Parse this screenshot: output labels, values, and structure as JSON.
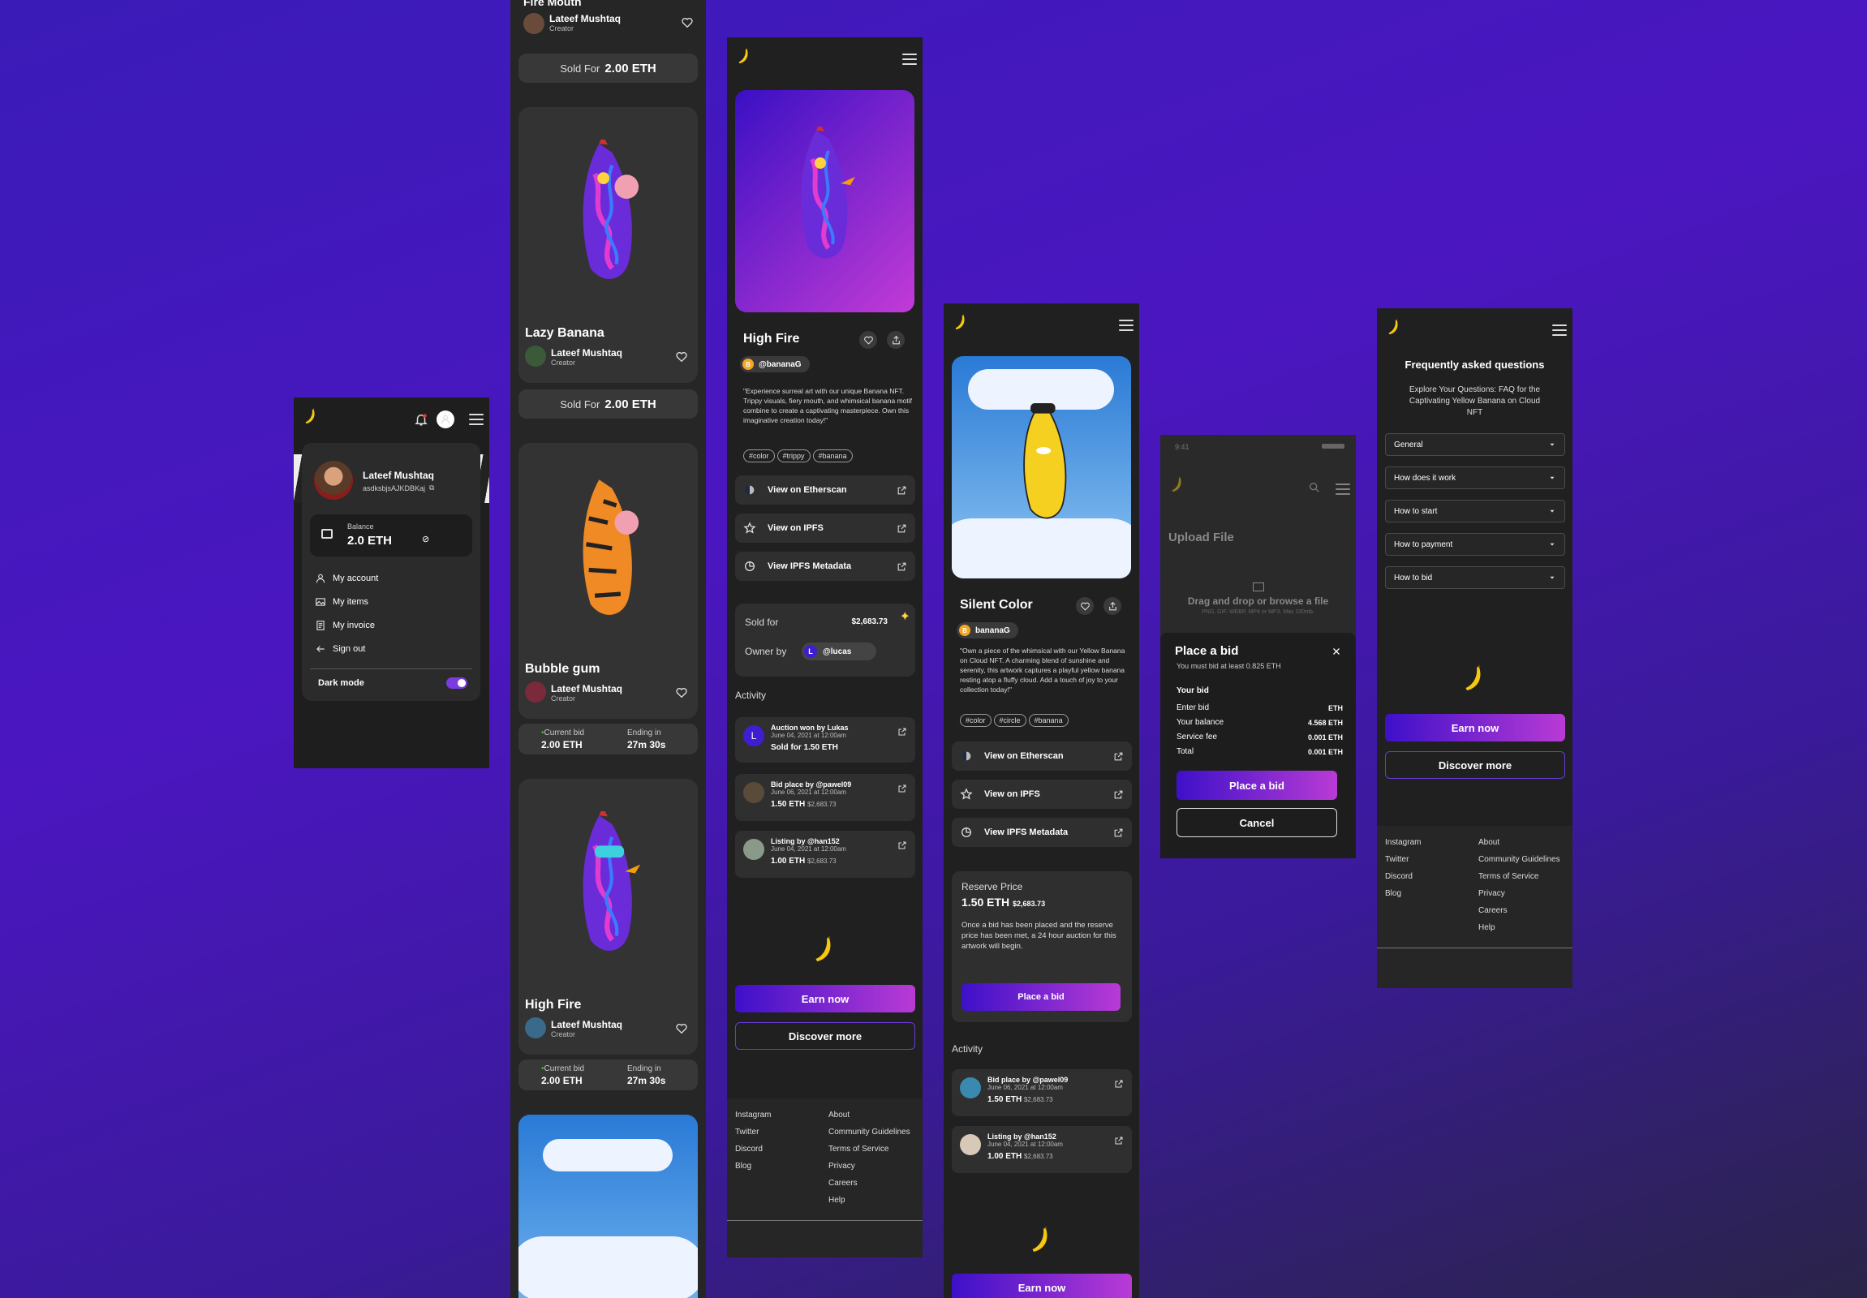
{
  "colors": {
    "bg": "#4315b5",
    "panel": "#202020",
    "card": "#333333",
    "accent_start": "#3d10c9",
    "accent_end": "#b93bd5"
  },
  "icons": [
    "banana-logo-icon",
    "bell-icon",
    "user-icon",
    "menu-icon",
    "heart-icon",
    "share-icon",
    "external-link-icon",
    "star-icon",
    "chart-icon",
    "copy-icon",
    "eye-off-icon",
    "close-icon",
    "search-icon",
    "image-icon",
    "sparkle-icon",
    "wallet-icon",
    "chevron-down-icon"
  ],
  "profile": {
    "name": "Lateef Mushtaq",
    "handle": "asdksbjsAJKDBKaj",
    "balance_label": "Balance",
    "balance": "2.0 ETH",
    "menu": [
      {
        "label": "My account",
        "icon": "user-icon"
      },
      {
        "label": "My items",
        "icon": "image-icon"
      },
      {
        "label": "My invoice",
        "icon": "invoice-icon"
      },
      {
        "label": "Sign out",
        "icon": "arrow-left-icon"
      }
    ],
    "dark_mode_label": "Dark mode",
    "dark_mode_on": true
  },
  "list": {
    "top_title": "Fire Mouth",
    "creator": "Lateef Mushtaq",
    "creator_role": "Creator",
    "sold_label": "Sold For",
    "sold_value": "2.00 ETH",
    "items": [
      {
        "title": "Lazy Banana"
      },
      {
        "title": "Bubble gum"
      },
      {
        "title": "High Fire"
      }
    ],
    "bid_label": "Current bid",
    "bid_value": "2.00 ETH",
    "ending_label": "Ending in",
    "ending_value": "27m 30s"
  },
  "detail1": {
    "title": "High Fire",
    "owner": "@bananaG",
    "owner_initial": "B",
    "desc": "\"Experience surreal art with our unique Banana NFT. Trippy visuals, fiery mouth, and whimsical banana motif combine to create a captivating masterpiece. Own this imaginative creation today!\"",
    "tags": [
      "#color",
      "#trippy",
      "#banana"
    ],
    "links": [
      "View on Etherscan",
      "View on IPFS",
      "View IPFS Metadata"
    ],
    "sold_for_label": "Sold for",
    "sold_for_value": "$2,683.73",
    "owner_by_label": "Owner by",
    "owner_by": "@lucas",
    "owner_by_initial": "L",
    "activity_label": "Activity",
    "activity": [
      {
        "title": "Auction won by Lukas",
        "date": "June 04, 2021 at 12:00am",
        "amount": "Sold for 1.50 ETH",
        "usd": ""
      },
      {
        "title": "Bid place by @pawel09",
        "date": "June 06, 2021 at 12:00am",
        "amount": "1.50 ETH",
        "usd": "$2,683.73"
      },
      {
        "title": "Listing by @han152",
        "date": "June 04, 2021 at 12:00am",
        "amount": "1.00 ETH",
        "usd": "$2,683.73"
      }
    ],
    "earn": "Earn now",
    "discover": "Discover more"
  },
  "footer": {
    "col1": [
      "Instagram",
      "Twitter",
      "Discord",
      "Blog"
    ],
    "col2": [
      "About",
      "Community Guidelines",
      "Terms of Service",
      "Privacy",
      "Careers",
      "Help"
    ]
  },
  "detail2": {
    "title": "Silent Color",
    "owner": "bananaG",
    "owner_initial": "B",
    "desc": "\"Own a piece of the whimsical with our Yellow Banana on Cloud NFT. A charming blend of sunshine and serenity, this artwork captures a playful yellow banana resting atop a fluffy cloud. Add a touch of joy to your collection today!\"",
    "tags": [
      "#color",
      "#circle",
      "#banana"
    ],
    "links": [
      "View on Etherscan",
      "View on IPFS",
      "View IPFS Metadata"
    ],
    "reserve_label": "Reserve Price",
    "reserve_eth": "1.50 ETH",
    "reserve_usd": "$2,683.73",
    "reserve_note": "Once a bid has been placed and the reserve price has been met, a 24 hour auction for this artwork will begin.",
    "place_bid": "Place a bid",
    "activity_label": "Activity",
    "activity": [
      {
        "title": "Bid place by @pawel09",
        "date": "June 06, 2021 at 12:00am",
        "amount": "1.50 ETH",
        "usd": "$2,683.73"
      },
      {
        "title": "Listing by @han152",
        "date": "June 04, 2021 at 12:00am",
        "amount": "1.00 ETH",
        "usd": "$2,683.73"
      }
    ],
    "earn": "Earn now"
  },
  "modal": {
    "time": "9:41",
    "bg_title": "Upload File",
    "drop_text": "Drag and drop or browse a file",
    "drop_sub": "PNG, GIF, WEBP, MP4 or MP3. Max 100mb.",
    "title": "Place a bid",
    "subtitle": "You must bid at least 0.825 ETH",
    "your_bid": "Your bid",
    "rows": [
      {
        "k": "Enter bid",
        "v": "ETH"
      },
      {
        "k": "Your balance",
        "v": "4.568 ETH"
      },
      {
        "k": "Service fee",
        "v": "0.001 ETH"
      },
      {
        "k": "Total",
        "v": "0.001 ETH"
      }
    ],
    "confirm": "Place a bid",
    "cancel": "Cancel"
  },
  "faq": {
    "title": "Frequently asked questions",
    "subtitle": "Explore Your Questions: FAQ for the Captivating Yellow Banana on Cloud NFT",
    "items": [
      "General",
      "How does it work",
      "How to start",
      "How to payment",
      "How to bid"
    ],
    "earn": "Earn now",
    "discover": "Discover more"
  }
}
